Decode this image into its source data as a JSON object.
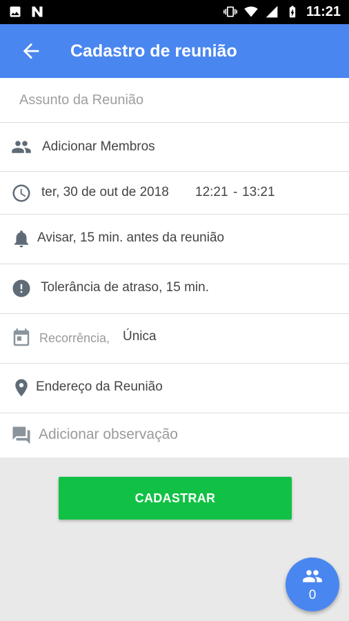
{
  "status_bar": {
    "time": "11:21"
  },
  "app_bar": {
    "title": "Cadastro de reunião"
  },
  "form": {
    "subject_placeholder": "Assunto da Reunião",
    "members_label": "Adicionar Membros",
    "date": "ter, 30 de out de 2018",
    "start_time": "12:21",
    "time_separator": "-",
    "end_time": "13:21",
    "alert": "Avisar, 15  min. antes da reunião",
    "tolerance": "Tolerância de atraso, 15  min.",
    "recurrence_label": "Recorrência,",
    "recurrence_value": "Única",
    "address_label": "Endereço da Reunião",
    "observation_placeholder": "Adicionar observação"
  },
  "actions": {
    "register_label": "CADASTRAR"
  },
  "fab": {
    "member_count": "0"
  },
  "colors": {
    "primary": "#4a86f0",
    "register": "#11c145",
    "background": "#e9e9e9"
  },
  "icons": [
    "image-icon",
    "n-notification-icon",
    "vibrate-icon",
    "wifi-icon",
    "signal-icon",
    "battery-icon",
    "back-arrow-icon",
    "people-icon",
    "clock-icon",
    "bell-icon",
    "alert-circle-icon",
    "calendar-icon",
    "location-pin-icon",
    "comment-icon"
  ]
}
